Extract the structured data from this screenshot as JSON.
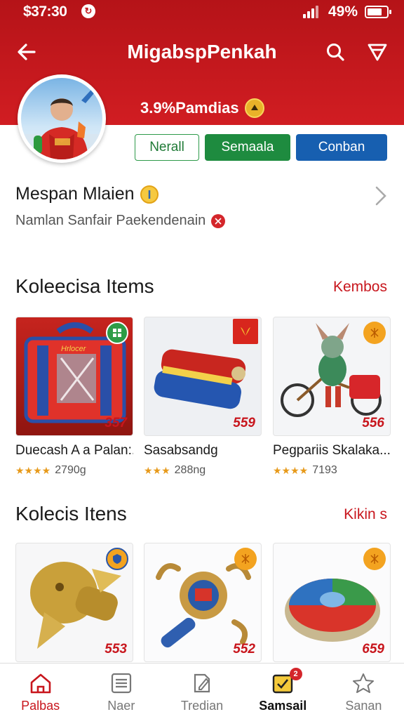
{
  "status_bar": {
    "time": "$37:30",
    "battery": "49%"
  },
  "app_bar": {
    "title": "MigabspPenkah"
  },
  "profile": {
    "headline": "3.9%Pamdias",
    "actions": [
      "Nerall",
      "Semaala",
      "Conban"
    ],
    "name": "Mespan Mlaien",
    "subtitle": "Namlan Sanfair Paekendenain"
  },
  "section1": {
    "title": "Koleecisa Items",
    "link": "Kembos",
    "items": [
      {
        "title": "Duecash A a Palan:...",
        "rating_text": "2790g",
        "price": "357"
      },
      {
        "title": "Sasabsandg",
        "rating_text": "288ng",
        "price": "559"
      },
      {
        "title": "Pegpariis Skalaka...",
        "rating_text": "7193",
        "price": "556"
      }
    ]
  },
  "section2": {
    "title": "Kolecis Itens",
    "link": "Kikin s",
    "items": [
      {
        "price": "553"
      },
      {
        "price": "552"
      },
      {
        "price": "659"
      }
    ]
  },
  "tab_bar": {
    "tabs": [
      {
        "label": "Palbas",
        "icon": "home-icon"
      },
      {
        "label": "Naer",
        "icon": "list-icon"
      },
      {
        "label": "Tredian",
        "icon": "edit-icon"
      },
      {
        "label": "Samsail",
        "icon": "checkbox-icon",
        "badge": "2"
      },
      {
        "label": "Sanan",
        "icon": "star-icon"
      }
    ]
  },
  "colors": {
    "brand_red": "#c8161d",
    "green": "#1e8b3f",
    "blue": "#175fb0",
    "star": "#e79a1b"
  }
}
